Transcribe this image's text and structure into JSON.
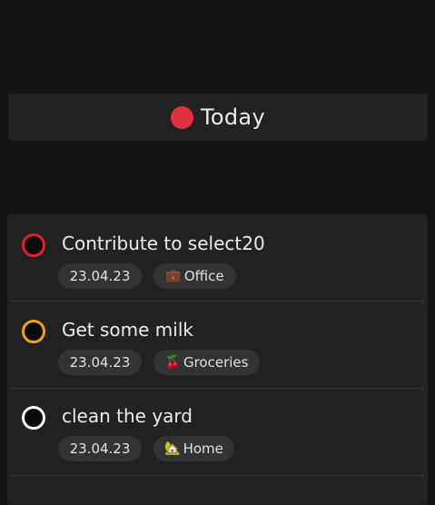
{
  "header": {
    "title": "Today",
    "dot_color": "#e0303f"
  },
  "tasks": [
    {
      "title": "Contribute to select20",
      "date": "23.04.23",
      "tag": "Office",
      "tag_icon": "💼",
      "tag_icon_name": "briefcase-icon",
      "ring_color": "#e0202f"
    },
    {
      "title": "Get some milk",
      "date": "23.04.23",
      "tag": "Groceries",
      "tag_icon": "🍒",
      "tag_icon_name": "cherries-icon",
      "ring_color": "#f0a020"
    },
    {
      "title": "clean the yard",
      "date": "23.04.23",
      "tag": "Home",
      "tag_icon": "🏡",
      "tag_icon_name": "house-icon",
      "ring_color": "#ffffff"
    }
  ]
}
